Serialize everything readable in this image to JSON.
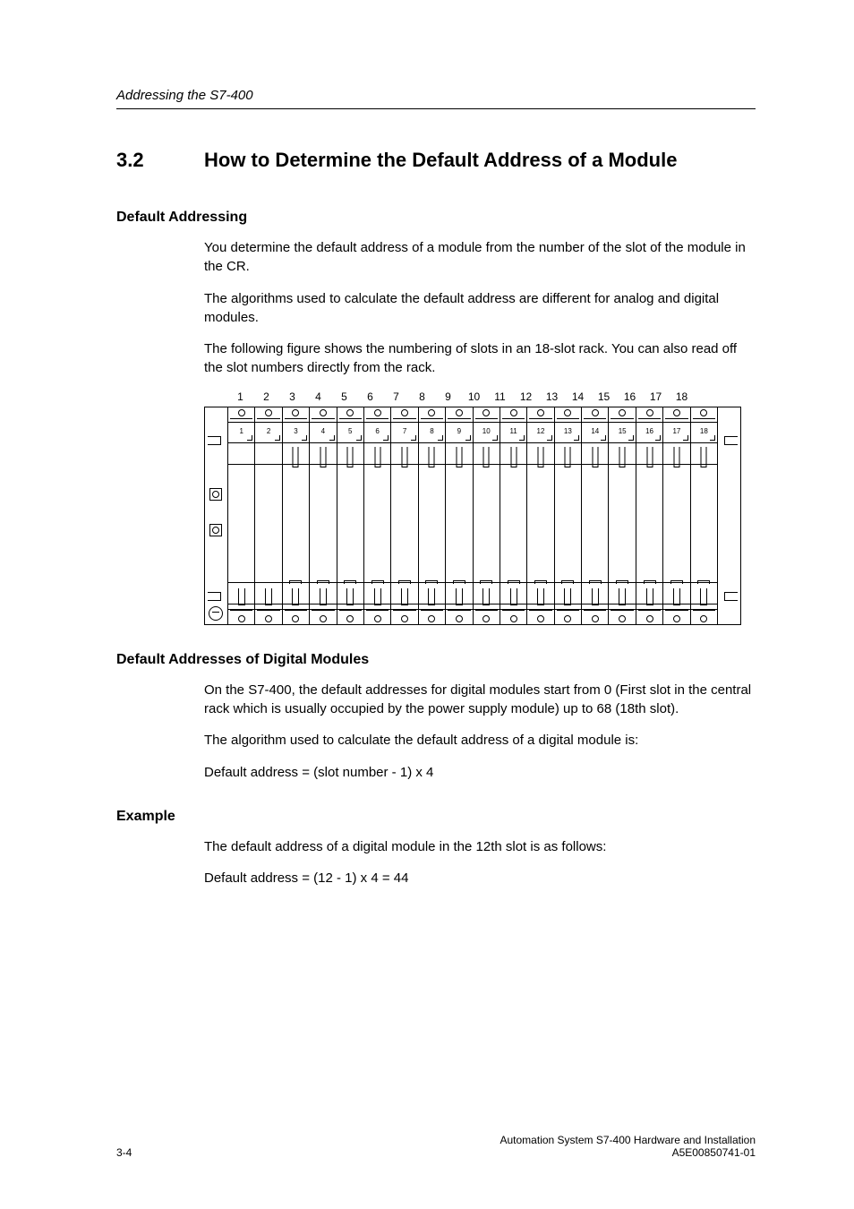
{
  "running_head": "Addressing the S7-400",
  "section": {
    "number": "3.2",
    "title": "How to Determine the Default Address of a Module"
  },
  "default_addressing": {
    "heading": "Default Addressing",
    "p1": "You determine the default address of a module from the number of the slot of the module in the CR.",
    "p2": "The algorithms used to calculate the default address are different for analog and digital modules.",
    "p3": "The following figure shows the numbering of slots in an 18-slot rack. You can also read off the slot numbers directly from the rack."
  },
  "rack": {
    "top_labels": [
      "1",
      "2",
      "3",
      "4",
      "5",
      "6",
      "7",
      "8",
      "9",
      "10",
      "11",
      "12",
      "13",
      "14",
      "15",
      "16",
      "17",
      "18"
    ],
    "slot_labels": [
      "1",
      "2",
      "3",
      "4",
      "5",
      "6",
      "7",
      "8",
      "9",
      "10",
      "11",
      "12",
      "13",
      "14",
      "15",
      "16",
      "17",
      "18"
    ]
  },
  "digital": {
    "heading": "Default Addresses of Digital Modules",
    "p1": "On the S7-400, the default addresses for digital modules start from 0 (First slot in the central rack which is usually occupied by the power supply module) up to 68 (18th slot).",
    "p2": "The algorithm used to calculate the default address of a digital module is:",
    "formula": "Default address  =  (slot number - 1) x 4"
  },
  "example": {
    "heading": "Example",
    "p1": "The default address of a digital module in the 12th slot is as follows:",
    "formula": "Default address  =  (12 - 1) x 4  = 44"
  },
  "footer": {
    "page": "3-4",
    "line1": "Automation System S7-400  Hardware and Installation",
    "line2": "A5E00850741-01"
  }
}
